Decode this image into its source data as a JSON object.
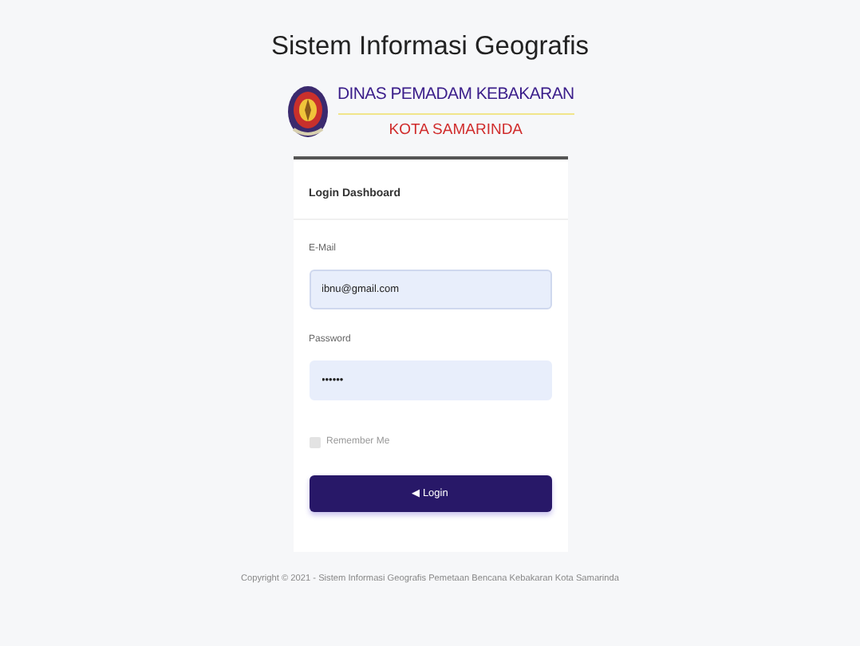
{
  "title": "Sistem Informasi Geografis",
  "brand": {
    "line_1": "DINAS PEMADAM KEBAKARAN",
    "line_2": "KOTA SAMARINDA"
  },
  "card": {
    "header": "Login Dashboard",
    "fields": [
      {
        "label": "E-Mail",
        "value": "ibnu@gmail.com",
        "kind": "text"
      },
      {
        "label": "Password",
        "value": "••••••",
        "kind": "password"
      }
    ],
    "remember": {
      "label": "Remember Me",
      "checked": false
    },
    "button": {
      "icon": "◀",
      "label": "Login"
    }
  },
  "footer": "Copyright © 2021 - Sistem Informasi Geografis Pemetaan Bencana Kebakaran Kota Samarinda"
}
